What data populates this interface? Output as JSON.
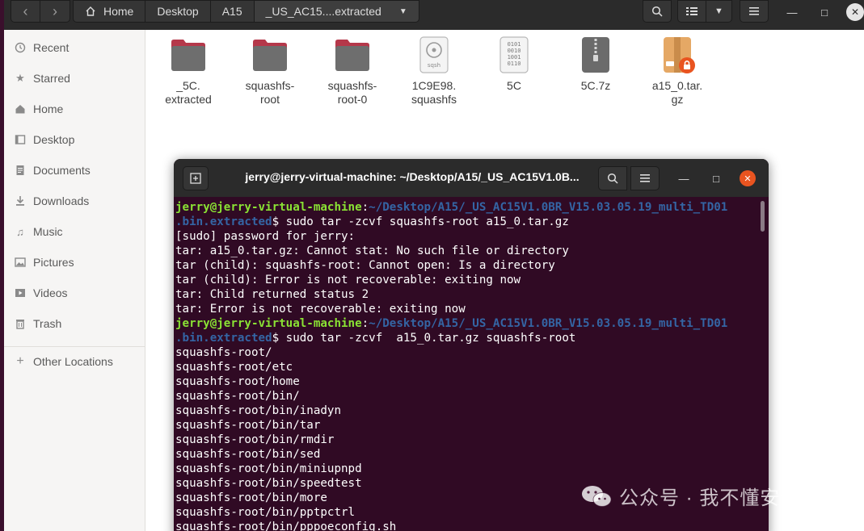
{
  "colors": {
    "headerbar": "#2b2b2b",
    "sidebar_bg": "#f6f5f4",
    "terminal_bg": "#300a24",
    "prompt_user": "#8ae234",
    "prompt_path": "#3465a4",
    "folder": "#6e6e6e",
    "folder_top": "#b5384a",
    "close_orange": "#e95420"
  },
  "header": {
    "back_icon": "chevron-left-icon",
    "forward_icon": "chevron-right-icon",
    "breadcrumbs": [
      "Home",
      "Desktop",
      "A15",
      "_US_AC15....extracted"
    ]
  },
  "sidebar": {
    "items": [
      {
        "label": "Recent",
        "icon": "clock-icon"
      },
      {
        "label": "Starred",
        "icon": "star-icon"
      },
      {
        "label": "Home",
        "icon": "home-icon"
      },
      {
        "label": "Desktop",
        "icon": "desktop-icon"
      },
      {
        "label": "Documents",
        "icon": "document-icon"
      },
      {
        "label": "Downloads",
        "icon": "download-icon"
      },
      {
        "label": "Music",
        "icon": "music-icon"
      },
      {
        "label": "Pictures",
        "icon": "picture-icon"
      },
      {
        "label": "Videos",
        "icon": "video-icon"
      },
      {
        "label": "Trash",
        "icon": "trash-icon"
      },
      {
        "label": "Other Locations",
        "icon": "plus-icon"
      }
    ]
  },
  "files": [
    {
      "line1": "_5C.",
      "line2": "extracted",
      "type": "folder"
    },
    {
      "line1": "squashfs-",
      "line2": "root",
      "type": "folder"
    },
    {
      "line1": "squashfs-",
      "line2": "root-0",
      "type": "folder"
    },
    {
      "line1": "1C9E98.",
      "line2": "squashfs",
      "type": "sqsh",
      "badge": "sqsh"
    },
    {
      "line1": "5C",
      "line2": "",
      "type": "binary",
      "bits": [
        "0101",
        "0010",
        "1001",
        "0110"
      ]
    },
    {
      "line1": "5C.7z",
      "line2": "",
      "type": "archive"
    },
    {
      "line1": "a15_0.tar.",
      "line2": "gz",
      "type": "locked-archive"
    }
  ],
  "terminal": {
    "title": "jerry@jerry-virtual-machine: ~/Desktop/A15/_US_AC15V1.0B...",
    "prompt_user": "jerry@jerry-virtual-machine",
    "prompt_path_1": "~/Desktop/A15/_US_AC15V1.0BR_V15.03.05.19_multi_TD01",
    "prompt_path_2": ".bin.extracted",
    "cmd1": "$ sudo tar -zcvf squashfs-root a15_0.tar.gz",
    "out1": [
      "[sudo] password for jerry:",
      "tar: a15_0.tar.gz: Cannot stat: No such file or directory",
      "tar (child): squashfs-root: Cannot open: Is a directory",
      "tar (child): Error is not recoverable: exiting now",
      "tar: Child returned status 2",
      "tar: Error is not recoverable: exiting now"
    ],
    "cmd2": "$ sudo tar -zcvf  a15_0.tar.gz squashfs-root",
    "out2": [
      "squashfs-root/",
      "squashfs-root/etc",
      "squashfs-root/home",
      "squashfs-root/bin/",
      "squashfs-root/bin/inadyn",
      "squashfs-root/bin/tar",
      "squashfs-root/bin/rmdir",
      "squashfs-root/bin/sed",
      "squashfs-root/bin/miniupnpd",
      "squashfs-root/bin/speedtest",
      "squashfs-root/bin/more",
      "squashfs-root/bin/pptpctrl",
      "squashfs-root/bin/pppoeconfig.sh"
    ]
  },
  "watermark": {
    "text": "公众号 · 我不懂安全"
  }
}
